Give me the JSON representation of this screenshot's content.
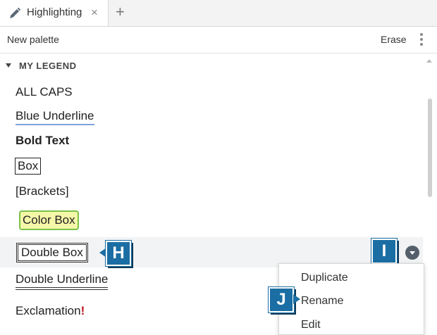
{
  "tab": {
    "label": "Highlighting",
    "close_glyph": "×",
    "add_glyph": "+"
  },
  "icons": {
    "tab_icon": "pencil-icon",
    "more_icon": "kebab-menu-icon",
    "dropdown_icon": "chevron-down-icon"
  },
  "toolbar": {
    "new_palette": "New palette",
    "erase": "Erase"
  },
  "section": {
    "title": "MY LEGEND"
  },
  "legend_items": [
    {
      "label": "ALL CAPS"
    },
    {
      "label": "Blue Underline"
    },
    {
      "label": "Bold Text"
    },
    {
      "label": "Box"
    },
    {
      "label": "[Brackets]"
    },
    {
      "label": "Color Box"
    },
    {
      "label": "Double Box"
    },
    {
      "label": "Double Underline"
    },
    {
      "label": "Exclamation",
      "suffix": "!"
    }
  ],
  "callouts": {
    "h": "H",
    "i": "I",
    "j": "J"
  },
  "context_menu": {
    "items": [
      "Duplicate",
      "Rename",
      "Edit"
    ]
  },
  "colors": {
    "accent_badge": "#1b6ea3",
    "blue_underline": "#7fa3db",
    "color_box_fill": "#f4f7a8",
    "color_box_border": "#7cc24a",
    "exclamation": "#c0121f"
  }
}
